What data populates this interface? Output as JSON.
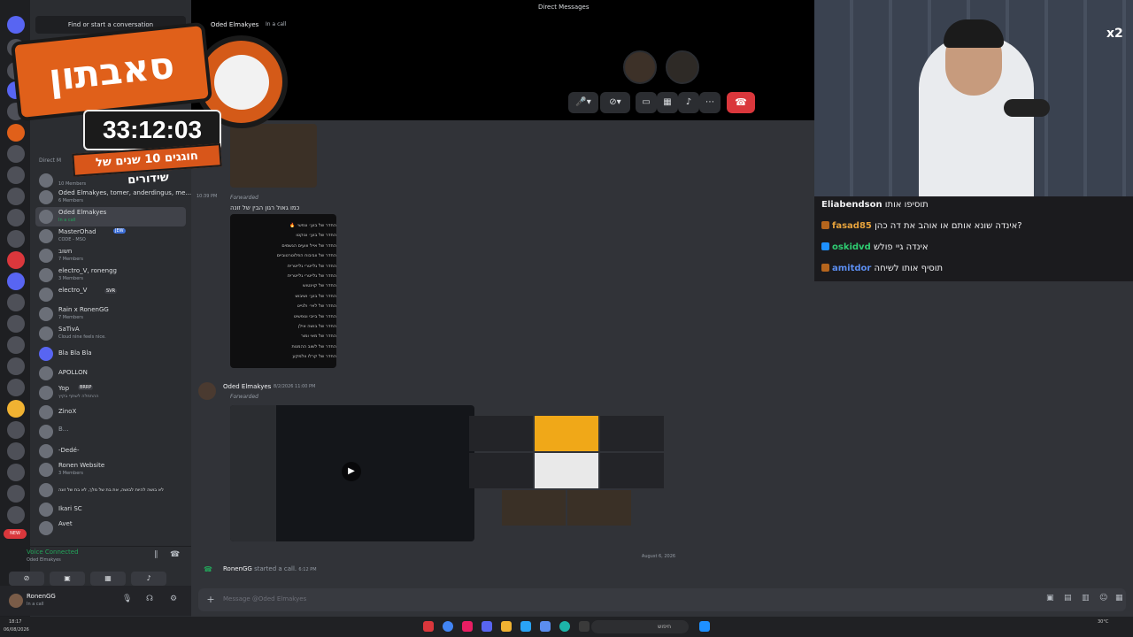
{
  "window": {
    "title": "Direct Messages"
  },
  "sidebar": {
    "find_placeholder": "Find or start a conversation",
    "section_label": "Direct M",
    "dms": [
      {
        "name": "",
        "sub": "10 Members"
      },
      {
        "name": "Oded Elmakyes, tomer, anderdingus, me...",
        "sub": "6 Members"
      },
      {
        "name": "Oded Elmakyes",
        "sub": "In a call",
        "selected": true
      },
      {
        "name": "MasterOhad",
        "badge": "JEW",
        "sub": "CODE - MSO"
      },
      {
        "name": "חשוב",
        "sub": "7 Members"
      },
      {
        "name": "electro_V, ronengg",
        "sub": "3 Members"
      },
      {
        "name": "electro_V",
        "badge": "SVR",
        "sub": ""
      },
      {
        "name": "Rain x RonenGG",
        "sub": "7 Members"
      },
      {
        "name": "SaTivA",
        "sub": "Cloud nine feels nice."
      },
      {
        "name": "Bla Bla Bla",
        "sub": ""
      },
      {
        "name": "APOLLON",
        "sub": ""
      },
      {
        "name": "Yop",
        "badge": "BRRP",
        "sub": "ההתחלה לשתף בקיץ"
      },
      {
        "name": "ZinoX",
        "sub": ""
      },
      {
        "name": "B...",
        "sub": ""
      },
      {
        "name": "-Dedé-",
        "sub": ""
      },
      {
        "name": "Ronen Website",
        "sub": "3 Members"
      },
      {
        "name": "לא בושה להיות לבושה, את בת של מלך, לא בת של זונה",
        "sub": ""
      },
      {
        "name": "Ikari SC",
        "sub": ""
      },
      {
        "name": "Avet",
        "sub": ""
      }
    ],
    "voice_title": "Voice Connected",
    "voice_sub": "Oded Elmakyes",
    "user_name": "RonenGG",
    "user_status": "In a call",
    "new_badge": "NEW"
  },
  "overlay": {
    "title": "סאבתון",
    "timer": "33:12:03",
    "subtitle": "חוגגים 10 שנים של שידורים"
  },
  "call": {
    "name": "Oded Elmakyes",
    "status": "In a call"
  },
  "messages": {
    "time1": "10:39 PM",
    "forwarded": "Forwarded",
    "caption": "כמו גאול רגון הבין של זונה",
    "list_rows": [
      "החדר של בוע׳ ונפש׳ 🔥",
      "החדר של בוע׳ ונוקטו",
      "החדר של אייל ווועים הגשמים",
      "החדר של ווביבוח הפלוטרטוביים",
      "החדר של גלייטרי גלייטרית",
      "החדר של גלייטרי גלייטרית",
      "החדר של קוינטוש",
      "החדר של בוע׳ ושיבוש",
      "החדר של לאי׳ ולגייט",
      "החדר של בייבי ונופשיט",
      "החדר של בושה אילן",
      "החדר של מאי ומור",
      "החדר של לשוב ההמנות",
      "החדר של קרלו וולמקע",
      "החדר של יוסאל"
    ],
    "author2": "Oded Elmakyes",
    "stamp2": "8/2/2026 11:00 PM",
    "forwarded2": "Forwarded",
    "date_sep": "August 6, 2026",
    "sys_user": "RonenGG",
    "sys_text": "started a call.",
    "sys_time": "6:12 PM",
    "composer_placeholder": "Message @Oded Elmakyes"
  },
  "stream_chat": [
    {
      "user": "Eliabendson",
      "color": "#efeff1",
      "msg": "תוסיפו אותו"
    },
    {
      "user": "fasad85",
      "color": "#e6a23c",
      "msg": "אינדה שונא אותם או אוהב את דה כהן?"
    },
    {
      "user": "oskidvd",
      "color": "#2ecc71",
      "msg": "אינדה גיי פולש"
    },
    {
      "user": "amitdor",
      "color": "#5b8def",
      "msg": "תוסיף אותו לשיחה"
    }
  ],
  "webcam": {
    "badge": "x2"
  },
  "taskbar": {
    "clock": "18:17",
    "date": "06/08/2026",
    "search": "חיפוש",
    "temp": "30°C"
  },
  "colors": {
    "accent": "#5865f2",
    "online": "#23a55a",
    "danger": "#da373c",
    "overlay_orange": "#e0601a"
  },
  "icons": [
    "discord-icon",
    "mic-icon",
    "camera-off-icon",
    "screen-share-icon",
    "activities-icon",
    "soundboard-icon",
    "more-icon",
    "hang-up-icon",
    "plus-icon",
    "headphones-icon",
    "settings-icon",
    "play-icon"
  ]
}
